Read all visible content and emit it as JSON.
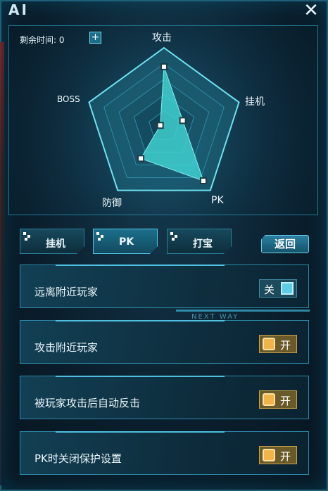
{
  "window": {
    "title": "AI",
    "close_label": "✕"
  },
  "radar": {
    "timer_label": "剩余时间: 0",
    "add_time_label": "+",
    "axes": [
      "攻击",
      "挂机",
      "PK",
      "防御",
      "BOSS"
    ],
    "values": [
      0.76,
      0.25,
      0.85,
      0.5,
      0.05
    ]
  },
  "tabs": [
    {
      "label": "挂机",
      "active": false
    },
    {
      "label": "PK",
      "active": true
    },
    {
      "label": "打宝",
      "active": false
    }
  ],
  "back_label": "返回",
  "settings": [
    {
      "label": "远离附近玩家",
      "state": "off",
      "state_text": "关"
    },
    {
      "label": "攻击附近玩家",
      "state": "on",
      "state_text": "开"
    },
    {
      "label": "被玩家攻击后自动反击",
      "state": "on",
      "state_text": "开"
    },
    {
      "label": "PK时关闭保护设置",
      "state": "on",
      "state_text": "开"
    }
  ],
  "decor_text": "NEXT WAY",
  "colors": {
    "accent": "#3fb6d8",
    "radar_fill": "#3fd0cf",
    "toggle_on": "#f1b44a",
    "toggle_off": "#5fcbe6"
  }
}
